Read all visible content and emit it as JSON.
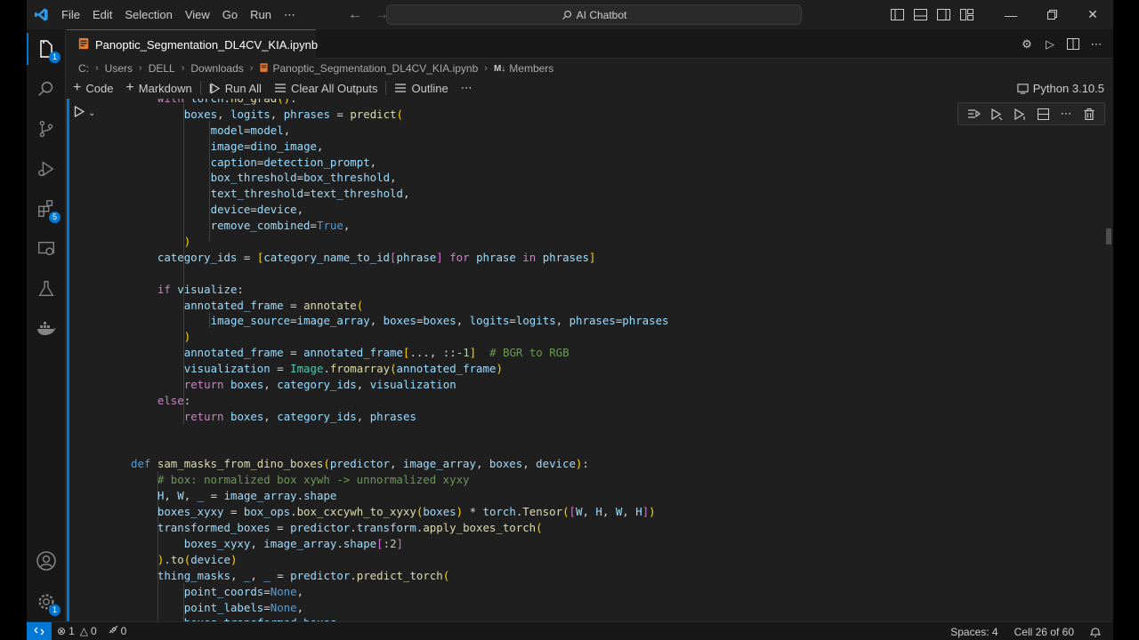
{
  "app": {
    "menu": [
      "File",
      "Edit",
      "Selection",
      "View",
      "Go",
      "Run",
      "⋯"
    ],
    "search_label": "AI Chatbot"
  },
  "activity_badges": {
    "explorer": "1",
    "extensions": "5",
    "manage": "1"
  },
  "tab": {
    "title": "Panoptic_Segmentation_DL4CV_KIA.ipynb"
  },
  "breadcrumb": [
    "C:",
    "Users",
    "DELL",
    "Downloads",
    "Panoptic_Segmentation_DL4CV_KIA.ipynb",
    "Members"
  ],
  "breadcrumb_md_badge": "M↓",
  "toolbar": {
    "code": "Code",
    "markdown": "Markdown",
    "run_all": "Run All",
    "clear_outputs": "Clear All Outputs",
    "outline": "Outline",
    "more": "⋯",
    "kernel": "Python 3.10.5"
  },
  "status": {
    "errors": "1",
    "warnings": "0",
    "ports": "0",
    "spaces": "Spaces: 4",
    "cell": "Cell 26 of 60"
  },
  "code_lines": [
    "    with torch.no_grad():",
    "        boxes, logits, phrases = predict(",
    "            model=model,",
    "            image=dino_image,",
    "            caption=detection_prompt,",
    "            box_threshold=box_threshold,",
    "            text_threshold=text_threshold,",
    "            device=device,",
    "            remove_combined=True,",
    "        )",
    "    category_ids = [category_name_to_id[phrase] for phrase in phrases]",
    "",
    "    if visualize:",
    "        annotated_frame = annotate(",
    "            image_source=image_array, boxes=boxes, logits=logits, phrases=phrases",
    "        )",
    "        annotated_frame = annotated_frame[..., ::-1]  # BGR to RGB",
    "        visualization = Image.fromarray(annotated_frame)",
    "        return boxes, category_ids, visualization",
    "    else:",
    "        return boxes, category_ids, phrases",
    "",
    "",
    "def sam_masks_from_dino_boxes(predictor, image_array, boxes, device):",
    "    # box: normalized box xywh -> unnormalized xyxy",
    "    H, W, _ = image_array.shape",
    "    boxes_xyxy = box_ops.box_cxcywh_to_xyxy(boxes) * torch.Tensor([W, H, W, H])",
    "    transformed_boxes = predictor.transform.apply_boxes_torch(",
    "        boxes_xyxy, image_array.shape[:2]",
    "    ).to(device)",
    "    thing_masks, _, _ = predictor.predict_torch(",
    "        point_coords=None,",
    "        point_labels=None,",
    "        boxes=transformed_boxes,"
  ]
}
